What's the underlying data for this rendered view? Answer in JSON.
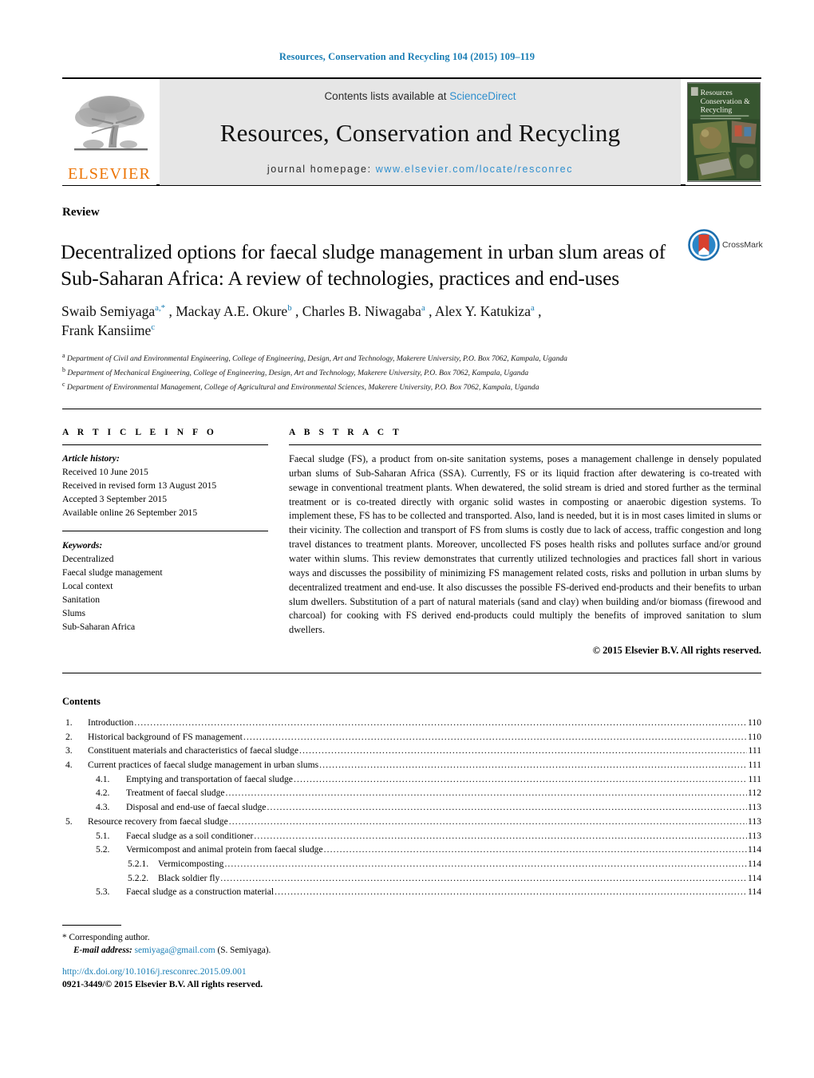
{
  "running_head": "Resources, Conservation and Recycling 104 (2015) 109–119",
  "masthead": {
    "contents_prefix": "Contents lists available at ",
    "sciencedirect": "ScienceDirect",
    "journal_title": "Resources, Conservation and Recycling",
    "homepage_prefix": "journal homepage: ",
    "homepage_url": "www.elsevier.com/locate/resconrec",
    "publisher": "ELSEVIER",
    "cover_title_line1": "Resources",
    "cover_title_line2": "Conservation &",
    "cover_title_line3": "Recycling",
    "link_color": "#2f8fce",
    "band_color": "#e6e6e6",
    "publisher_color": "#ec7404"
  },
  "article": {
    "type": "Review",
    "title": "Decentralized options for faecal sludge management in urban slum areas of Sub-Saharan Africa: A review of technologies, practices and end-uses",
    "crossmark_label": "CrossMark",
    "authors_line1_parts": [
      {
        "name": "Swaib Semiyaga",
        "sup": "a,*"
      },
      {
        "name": ", Mackay A.E. Okure",
        "sup": "b"
      },
      {
        "name": ", Charles B. Niwagaba",
        "sup": "a"
      },
      {
        "name": ", Alex Y. Katukiza",
        "sup": "a"
      },
      {
        "name": ",",
        "sup": ""
      }
    ],
    "authors_line2_parts": [
      {
        "name": "Frank Kansiime",
        "sup": "c"
      }
    ],
    "affiliations": [
      {
        "marker": "a",
        "text": "Department of Civil and Environmental Engineering, College of Engineering, Design, Art and Technology, Makerere University, P.O. Box 7062, Kampala, Uganda"
      },
      {
        "marker": "b",
        "text": "Department of Mechanical Engineering, College of Engineering, Design, Art and Technology, Makerere University, P.O. Box 7062, Kampala, Uganda"
      },
      {
        "marker": "c",
        "text": "Department of Environmental Management, College of Agricultural and Environmental Sciences, Makerere University, P.O. Box 7062, Kampala, Uganda"
      }
    ]
  },
  "article_info": {
    "heading": "A R T I C L E   I N F O",
    "history_label": "Article history:",
    "history": [
      "Received 10 June 2015",
      "Received in revised form 13 August 2015",
      "Accepted 3 September 2015",
      "Available online 26 September 2015"
    ],
    "keywords_label": "Keywords:",
    "keywords": [
      "Decentralized",
      "Faecal sludge management",
      "Local context",
      "Sanitation",
      "Slums",
      "Sub-Saharan Africa"
    ]
  },
  "abstract": {
    "heading": "A B S T R A C T",
    "body": "Faecal sludge (FS), a product from on-site sanitation systems, poses a management challenge in densely populated urban slums of Sub-Saharan Africa (SSA). Currently, FS or its liquid fraction after dewatering is co-treated with sewage in conventional treatment plants. When dewatered, the solid stream is dried and stored further as the terminal treatment or is co-treated directly with organic solid wastes in composting or anaerobic digestion systems. To implement these, FS has to be collected and transported. Also, land is needed, but it is in most cases limited in slums or their vicinity. The collection and transport of FS from slums is costly due to lack of access, traffic congestion and long travel distances to treatment plants. Moreover, uncollected FS poses health risks and pollutes surface and/or ground water within slums. This review demonstrates that currently utilized technologies and practices fall short in various ways and discusses the possibility of minimizing FS management related costs, risks and pollution in urban slums by decentralized treatment and end-use. It also discusses the possible FS-derived end-products and their benefits to urban slum dwellers. Substitution of a part of natural materials (sand and clay) when building and/or biomass (firewood and charcoal) for cooking with FS derived end-products could multiply the benefits of improved sanitation to slum dwellers.",
    "copyright": "© 2015 Elsevier B.V. All rights reserved."
  },
  "contents": {
    "heading": "Contents",
    "entries": [
      {
        "level": 1,
        "number": "1.",
        "label": "Introduction",
        "page": "110"
      },
      {
        "level": 1,
        "number": "2.",
        "label": "Historical background of FS management",
        "page": "110"
      },
      {
        "level": 1,
        "number": "3.",
        "label": "Constituent materials and characteristics of faecal sludge",
        "page": "111"
      },
      {
        "level": 1,
        "number": "4.",
        "label": "Current practices of faecal sludge management in urban slums",
        "page": "111"
      },
      {
        "level": 2,
        "number": "4.1.",
        "label": "Emptying and transportation of faecal sludge",
        "page": "111"
      },
      {
        "level": 2,
        "number": "4.2.",
        "label": "Treatment of faecal sludge",
        "page": "112"
      },
      {
        "level": 2,
        "number": "4.3.",
        "label": "Disposal and end-use of faecal sludge",
        "page": "113"
      },
      {
        "level": 1,
        "number": "5.",
        "label": "Resource recovery from faecal sludge",
        "page": "113"
      },
      {
        "level": 2,
        "number": "5.1.",
        "label": "Faecal sludge as a soil conditioner",
        "page": "113"
      },
      {
        "level": 2,
        "number": "5.2.",
        "label": "Vermicompost and animal protein from faecal sludge",
        "page": "114"
      },
      {
        "level": 3,
        "number": "5.2.1.",
        "label": "Vermicomposting",
        "page": "114"
      },
      {
        "level": 3,
        "number": "5.2.2.",
        "label": "Black soldier fly",
        "page": "114"
      },
      {
        "level": 2,
        "number": "5.3.",
        "label": "Faecal sludge as a construction material",
        "page": "114"
      }
    ]
  },
  "footer": {
    "corresponding_marker": "*",
    "corresponding_text": "Corresponding author.",
    "email_label": "E-mail address:",
    "email": "semiyaga@gmail.com",
    "email_owner": "(S. Semiyaga).",
    "doi": "http://dx.doi.org/10.1016/j.resconrec.2015.09.001",
    "issn_line": "0921-3449/© 2015 Elsevier B.V. All rights reserved."
  }
}
